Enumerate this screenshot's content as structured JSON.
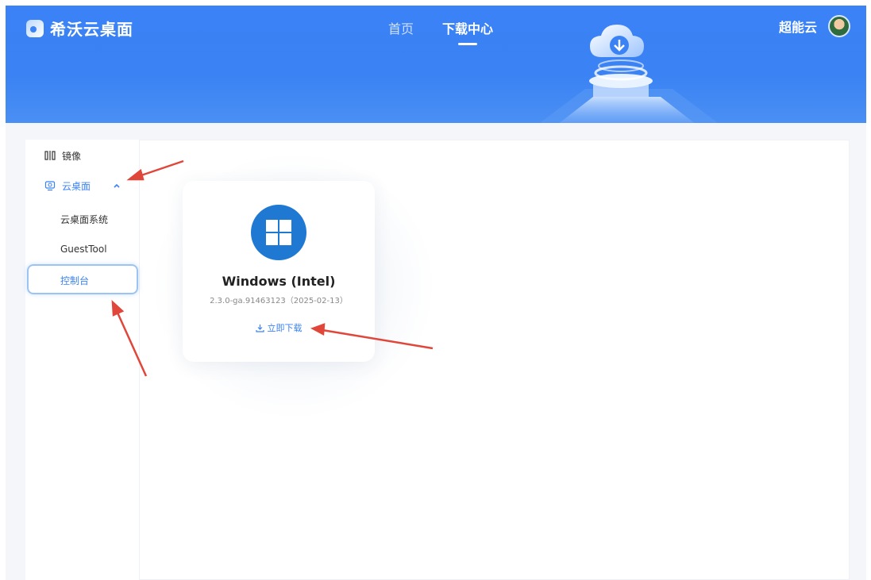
{
  "header": {
    "logo_text": "希沃云桌面",
    "nav": [
      {
        "label": "首页",
        "active": false
      },
      {
        "label": "下载中心",
        "active": true
      }
    ],
    "user_name": "超能云"
  },
  "sidebar": {
    "items": [
      {
        "label": "镜像",
        "icon": "mirror-icon"
      },
      {
        "label": "云桌面",
        "icon": "cloud-desktop-icon",
        "expanded": true,
        "toggle_icon": "chevron-up-icon"
      },
      {
        "label": "云桌面系统"
      },
      {
        "label": "GuestTool"
      },
      {
        "label": "控制台",
        "selected": true
      }
    ]
  },
  "card": {
    "icon": "windows-logo-icon",
    "title": "Windows (Intel)",
    "version": "2.3.0-ga.91463123（2025-02-13）",
    "download_label": "立即下载",
    "download_icon": "download-icon"
  },
  "colors": {
    "accent": "#3b83f4",
    "header_bg": "#3a82f5",
    "annotation_arrow": "#e0473a"
  }
}
